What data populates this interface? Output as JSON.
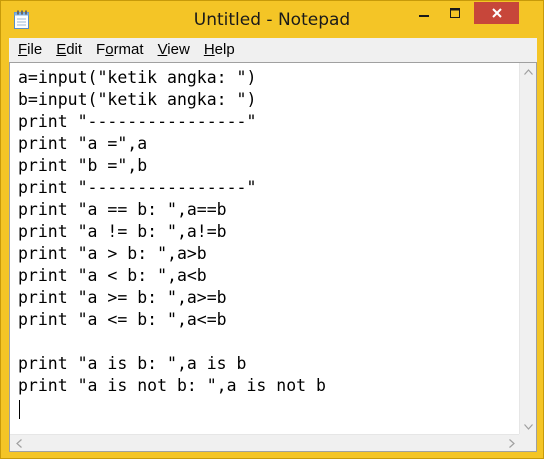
{
  "window": {
    "title": "Untitled - Notepad",
    "frame_color": "#f4c526",
    "close_color": "#c7463a"
  },
  "menu": [
    {
      "underline": "F",
      "rest": "ile"
    },
    {
      "underline": "E",
      "rest": "dit"
    },
    {
      "underline": "",
      "pre": "F",
      "mid": "o",
      "post": "rmat"
    },
    {
      "underline": "V",
      "rest": "iew"
    },
    {
      "underline": "H",
      "rest": "elp"
    }
  ],
  "editor": {
    "lines": [
      "a=input(\"ketik angka: \")",
      "b=input(\"ketik angka: \")",
      "print \"----------------\"",
      "print \"a =\",a",
      "print \"b =\",b",
      "print \"----------------\"",
      "print \"a == b: \",a==b",
      "print \"a != b: \",a!=b",
      "print \"a > b: \",a>b",
      "print \"a < b: \",a<b",
      "print \"a >= b: \",a>=b",
      "print \"a <= b: \",a<=b",
      "",
      "print \"a is b: \",a is b",
      "print \"a is not b: \",a is not b"
    ]
  },
  "icons": {
    "app": "notepad-icon",
    "minimize": "minimize-icon",
    "maximize": "maximize-icon",
    "close": "close-icon"
  }
}
